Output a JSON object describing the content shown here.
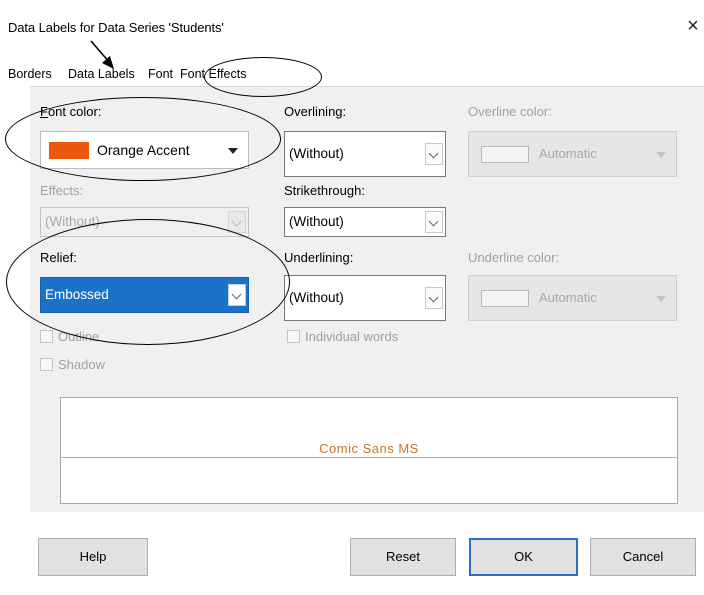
{
  "dialog": {
    "title": "Data Labels for Data Series 'Students'",
    "close_glyph": "×"
  },
  "tabs": [
    {
      "label": "Borders",
      "active": false
    },
    {
      "label": "Data Labels",
      "active": false
    },
    {
      "label": "Font",
      "active": false
    },
    {
      "label": "Font Effects",
      "active": true
    }
  ],
  "font_color": {
    "label": "Font color:",
    "value": "Orange Accent",
    "swatch": "#ea580c",
    "enabled": true
  },
  "effects": {
    "label": "Effects:",
    "value": "(Without)",
    "enabled": false
  },
  "relief": {
    "label": "Relief:",
    "value": "Embossed",
    "enabled": true,
    "selected": true
  },
  "overlining": {
    "label": "Overlining:",
    "value": "(Without)",
    "color_label": "Overline color:",
    "color_value": "Automatic",
    "color_enabled": false
  },
  "strikethrough": {
    "label": "Strikethrough:",
    "value": "(Without)"
  },
  "underlining": {
    "label": "Underlining:",
    "value": "(Without)",
    "color_label": "Underline color:",
    "color_value": "Automatic",
    "color_enabled": false
  },
  "checkboxes": {
    "outline": {
      "label": "Outline",
      "checked": false,
      "enabled": false
    },
    "shadow": {
      "label": "Shadow",
      "checked": false,
      "enabled": false
    },
    "individual_words": {
      "label": "Individual words",
      "checked": false,
      "enabled": false
    }
  },
  "preview": {
    "text": "Comic Sans MS",
    "text_color": "#c87528"
  },
  "buttons": {
    "help": "Help",
    "reset": "Reset",
    "ok": "OK",
    "cancel": "Cancel"
  },
  "colors": {
    "accent": "#2a6fcc",
    "selection": "#1a73c9",
    "panel": "#f0f0f0"
  },
  "annotations": {
    "ovals": [
      "tab-font-effects",
      "font-color",
      "relief"
    ],
    "arrow_target": "tab-data-labels"
  }
}
